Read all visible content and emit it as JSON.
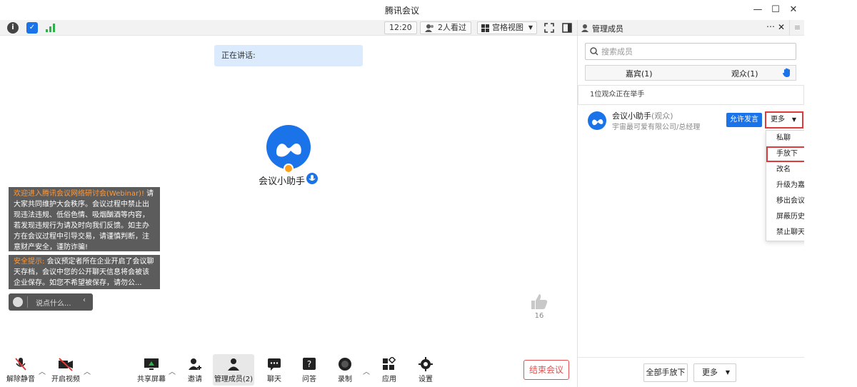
{
  "window": {
    "title": "腾讯会议",
    "controls": [
      "—",
      "☐",
      "✕"
    ]
  },
  "topbar": {
    "time": "12:20",
    "viewers": "2人看过",
    "view_mode": "宫格视图"
  },
  "stage": {
    "speaking_label": "正在讲话:",
    "main_participant": "会议小助手"
  },
  "chat": {
    "msg1_highlight": "欢迎进入腾讯会议网络研讨会(Webinar)!",
    "msg1_body": "请大家共同维护大会秩序。会议过程中禁止出现违法违规、低俗色情、吸烟酗酒等内容，若发现违规行为请及时向我们反馈。如主办方在会议过程中引导交易，请谨慎判断，注意财产安全，谨防诈骗!",
    "msg2_highlight": "安全提示:",
    "msg2_body": "会议预定者所在企业开启了会议聊天存档，会议中您的公开聊天信息将会被该企业保存。如您不希望被保存，请勿公...",
    "input_placeholder": "说点什么..."
  },
  "like": {
    "count": "16"
  },
  "bottombar": {
    "unmute": "解除静音",
    "video": "开启视频",
    "share": "共享屏幕",
    "invite": "邀请",
    "members": "管理成员(2)",
    "chat": "聊天",
    "qa": "问答",
    "record": "录制",
    "apps": "应用",
    "settings": "设置",
    "end": "结束会议"
  },
  "panel": {
    "title": "管理成员",
    "search_placeholder": "搜索成员",
    "tab_guests": "嘉宾(1)",
    "tab_audience": "观众(1)",
    "hand_raise_notice": "1位观众正在举手",
    "member": {
      "name": "会议小助手",
      "role": "(观众)",
      "org": "宇宙最可爱有限公司/总经理",
      "allow_label": "允许发言",
      "more_label": "更多"
    },
    "menu": [
      "私聊",
      "手放下",
      "改名",
      "升级为嘉宾",
      "移出会议",
      "屏蔽历史聊天消息",
      "禁止聊天"
    ],
    "footer_lower_all": "全部手放下",
    "footer_more": "更多"
  },
  "colors": {
    "accent": "#1a73e8",
    "highlight_border": "#e03a3a",
    "chat_highlight": "#ff9a3c"
  }
}
